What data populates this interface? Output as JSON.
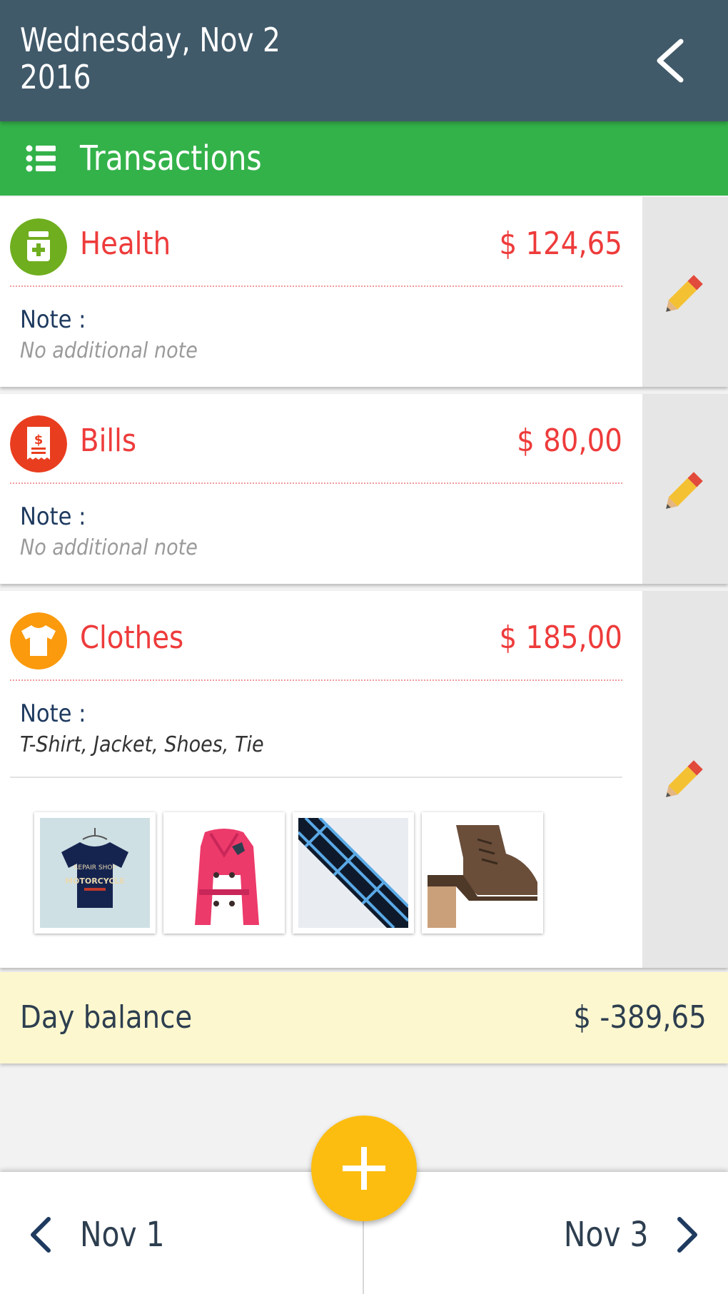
{
  "header": {
    "date_line1": "Wednesday, Nov 2",
    "date_line2": "2016",
    "back_icon": "chevron-left-icon"
  },
  "toolbar": {
    "title": "Transactions",
    "icon": "list-icon"
  },
  "transactions": [
    {
      "category": "Health",
      "amount": "$ 124,65",
      "note_label": "Note :",
      "note": "No additional note",
      "icon": "medicine-icon",
      "icon_color": "#6fae1e"
    },
    {
      "category": "Bills",
      "amount": "$ 80,00",
      "note_label": "Note :",
      "note": "No additional note",
      "icon": "receipt-icon",
      "icon_color": "#e93d1f"
    },
    {
      "category": "Clothes",
      "amount": "$ 185,00",
      "note_label": "Note :",
      "note": "T-Shirt, Jacket, Shoes, Tie",
      "icon": "tshirt-icon",
      "icon_color": "#fb9a0d",
      "photos": [
        "tshirt-photo",
        "jacket-photo",
        "tie-photo",
        "shoe-photo"
      ]
    }
  ],
  "balance": {
    "label": "Day balance",
    "value": "$ -389,65"
  },
  "nav": {
    "prev": "Nov 1",
    "next": "Nov 3"
  },
  "colors": {
    "header": "#415a6a",
    "toolbar": "#34b24a",
    "amount": "#ee3b3b",
    "fab": "#fdbd10",
    "balance_bg": "#fdf7cf"
  }
}
